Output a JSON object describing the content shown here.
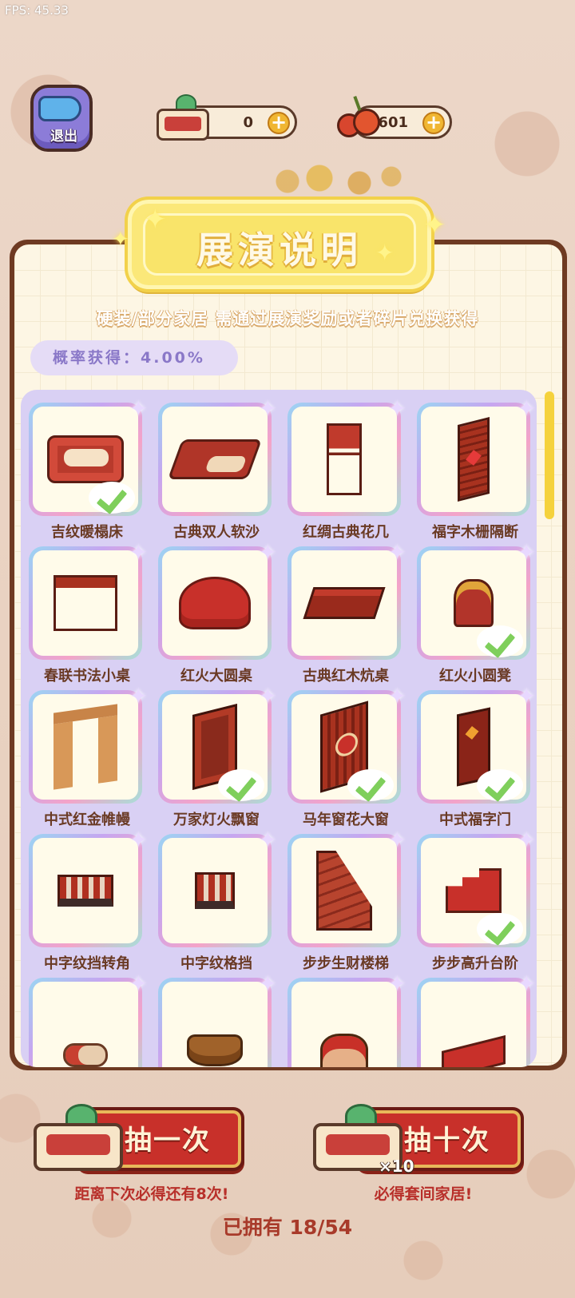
{
  "fps": "FPS: 45.33",
  "header": {
    "exit_label": "退出",
    "ticket_count": "0",
    "cherry_count": "1601"
  },
  "panel": {
    "title": "展演说明",
    "subtitle": "硬装/部分家居 需通过展演奖励或者碎片兑换获得",
    "probability": "概率获得：4.00%"
  },
  "items": [
    {
      "name": "吉纹暖榻床",
      "owned": true,
      "icon": "bed"
    },
    {
      "name": "古典双人软沙",
      "owned": false,
      "icon": "sofa"
    },
    {
      "name": "红绸古典花几",
      "owned": false,
      "icon": "stand"
    },
    {
      "name": "福字木栅隔断",
      "owned": false,
      "icon": "screen"
    },
    {
      "name": "春联书法小桌",
      "owned": false,
      "icon": "desk"
    },
    {
      "name": "红火大圆桌",
      "owned": false,
      "icon": "round"
    },
    {
      "name": "古典红木炕桌",
      "owned": false,
      "icon": "kang"
    },
    {
      "name": "红火小圆凳",
      "owned": true,
      "icon": "stool"
    },
    {
      "name": "中式红金帷幔",
      "owned": false,
      "icon": "curtain"
    },
    {
      "name": "万家灯火飘窗",
      "owned": true,
      "icon": "window"
    },
    {
      "name": "马年窗花大窗",
      "owned": true,
      "icon": "window2"
    },
    {
      "name": "中式福字门",
      "owned": true,
      "icon": "door"
    },
    {
      "name": "中字纹挡转角",
      "owned": false,
      "icon": "rail"
    },
    {
      "name": "中字纹格挡",
      "owned": false,
      "icon": "rail2"
    },
    {
      "name": "步步生财楼梯",
      "owned": false,
      "icon": "stairs"
    },
    {
      "name": "步步高升台阶",
      "owned": true,
      "icon": "steps"
    },
    {
      "name": "",
      "owned": false,
      "icon": "scroll"
    },
    {
      "name": "",
      "owned": false,
      "icon": "basket"
    },
    {
      "name": "",
      "owned": false,
      "icon": "horse"
    },
    {
      "name": "",
      "owned": false,
      "icon": "banner"
    }
  ],
  "actions": {
    "draw_one_label": "抽一次",
    "draw_ten_label": "抽十次",
    "draw_ten_badge": "×10",
    "draw_one_hint": "距离下次必得还有8次!",
    "draw_ten_hint": "必得套间家居!",
    "owned_text": "已拥有 18/54"
  },
  "colors": {
    "background": "#e9d3c4",
    "panel_border": "#6e3a22",
    "title_plate": "#fbe879",
    "grid_bg": "#d9d0f4",
    "draw_button": "#c8302a",
    "owned_check": "#7fcf5c"
  }
}
